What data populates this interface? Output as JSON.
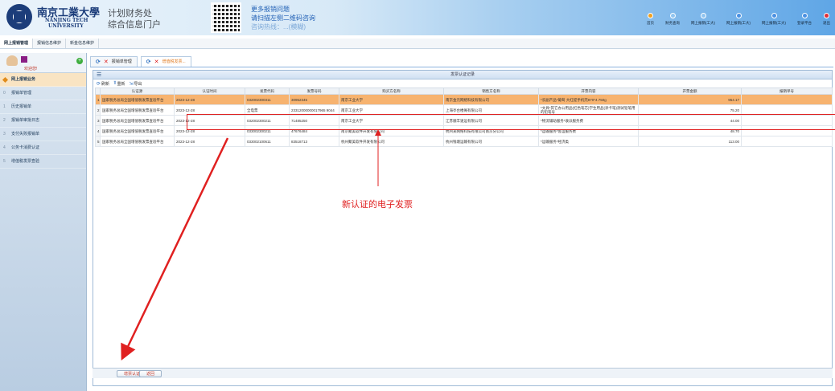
{
  "header": {
    "university_cn": "南京工業大學",
    "university_en_1": "NANJING TECH",
    "university_en_2": "UNIVERSITY",
    "portal_line1": "计划财务处",
    "portal_line2": "综合信息门户",
    "qr_line1": "更多报销问题",
    "qr_line2": "请扫描左侧二维码咨询",
    "qr_line3": "咨询热线：...(模糊)"
  },
  "topnav": [
    {
      "label": "首页",
      "color": "#f0a020",
      "icon": "home-icon"
    },
    {
      "label": "财务查询",
      "color": "#8fc4f0",
      "icon": "query-icon"
    },
    {
      "label": "网上报销(工大)",
      "color": "#8fc4f0",
      "icon": "reimburse-icon"
    },
    {
      "label": "网上报销(工大)",
      "color": "#4a90e2",
      "icon": "reimburse-icon"
    },
    {
      "label": "网上报销(工大)",
      "color": "#4a90e2",
      "icon": "reimburse-icon"
    },
    {
      "label": "登录平台",
      "color": "#4a90e2",
      "icon": "platform-icon"
    },
    {
      "label": "退出",
      "color": "#e0303a",
      "icon": "logout-icon"
    }
  ],
  "modbar": [
    "网上报销管理",
    "报销信息维护",
    "新金信息维护"
  ],
  "sidebar": {
    "welcome": "欢迎您!",
    "items": [
      {
        "label": "网上报销业务",
        "num": ""
      },
      {
        "label": "报销单管理",
        "num": "0"
      },
      {
        "label": "历史报销单",
        "num": "1"
      },
      {
        "label": "报销单审批日志",
        "num": "2"
      },
      {
        "label": "支付失败报销单",
        "num": "3"
      },
      {
        "label": "公务卡消费认证",
        "num": "4"
      },
      {
        "label": "增值税发票查验",
        "num": "5"
      }
    ]
  },
  "tabs": [
    {
      "label": "报销单管理"
    },
    {
      "label": "增值税发票..."
    }
  ],
  "panel": {
    "title": "发票认证记录",
    "toolbar": [
      "刷新",
      "重新",
      "导出"
    ]
  },
  "table": {
    "columns": [
      "",
      "认证源",
      "认证时间",
      "发票代码",
      "发票号码",
      "购买方名称",
      "销售方名称",
      "开票内容",
      "开票金额",
      "报销单号"
    ],
    "rows": [
      [
        "1",
        "国家税务总局全国增值税发票查验平台",
        "2023-12-28",
        "032002300311",
        "30952345",
        "南京工业大学",
        "南京金元网络科技有限公司",
        "*农副产品*葡萄 大红提手机壳870*4.750g",
        "954.17",
        ""
      ],
      [
        "2",
        "国家税务总局全国增值税发票查验平台",
        "2023-12-28",
        "全电票",
        "23312000000017965 9044",
        "南京工业大学",
        "上海亭台楼阁有限公司",
        "*文具*其它办公用品(红色笔芯)学生用品(涂卡笔)测试铅笔用的铅笔号",
        "75.20",
        ""
      ],
      [
        "3",
        "国家税务总局全国增值税发票查验平台",
        "2023-12-28",
        "032002300211",
        "71485250",
        "南京工业大学",
        "江苏顺丰速运有限公司",
        "*物流辅助服务*收派服务费",
        "44.00",
        ""
      ],
      [
        "4",
        "国家税务总局全国增值税发票查验平台",
        "2023-12-28",
        "033002300211",
        "47676484",
        "南京聚美软件开发有限公司",
        "杭州某网络科技有限公司南京分公司",
        "*运输服务*客运服务费",
        "48.70",
        ""
      ],
      [
        "5",
        "国家税务总局全国增值税发票查验平台",
        "2023-12-28",
        "033002100611",
        "83518713",
        "杭州聚美软件开发有限公司",
        "杭州钱塘运输有限公司",
        "*运输服务*经济类",
        "113.00",
        ""
      ]
    ]
  },
  "annotation": "新认证的电子发票",
  "footer": {
    "verify": "增票认证",
    "back": "返回"
  },
  "colors": {
    "annotation": "#e02020",
    "selected_row": "#f7b36f"
  }
}
